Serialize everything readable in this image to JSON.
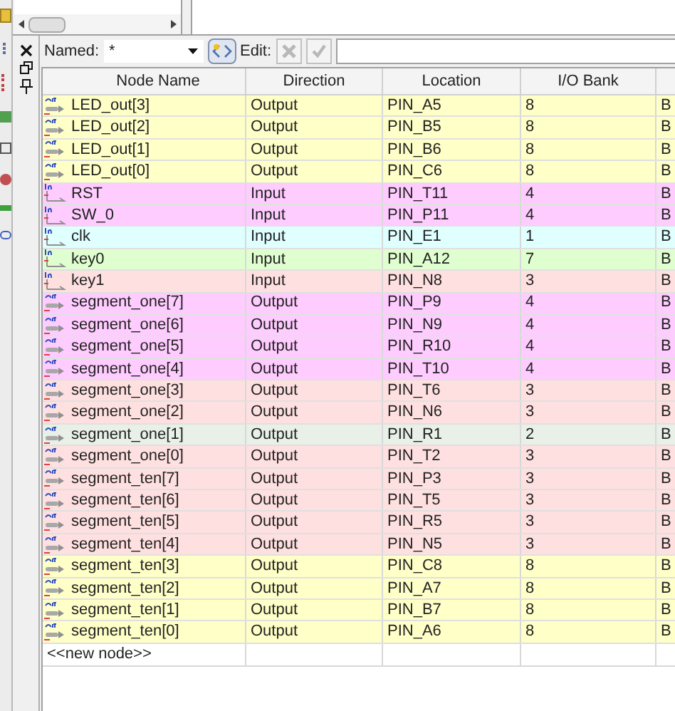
{
  "toolbar": {
    "named_label": "Named:",
    "named_value": "*",
    "edit_label": "Edit:"
  },
  "table": {
    "columns": [
      "Node Name",
      "Direction",
      "Location",
      "I/O Bank"
    ],
    "rows": [
      {
        "kind": "out",
        "name": "LED_out[3]",
        "direction": "Output",
        "location": "PIN_A5",
        "bank": "8",
        "column_5": "B",
        "color": "#ffffc8"
      },
      {
        "kind": "out",
        "name": "LED_out[2]",
        "direction": "Output",
        "location": "PIN_B5",
        "bank": "8",
        "column_5": "B",
        "color": "#ffffc8"
      },
      {
        "kind": "out",
        "name": "LED_out[1]",
        "direction": "Output",
        "location": "PIN_B6",
        "bank": "8",
        "column_5": "B",
        "color": "#ffffc8"
      },
      {
        "kind": "out",
        "name": "LED_out[0]",
        "direction": "Output",
        "location": "PIN_C6",
        "bank": "8",
        "column_5": "B",
        "color": "#ffffc8"
      },
      {
        "kind": "in",
        "name": "RST",
        "direction": "Input",
        "location": "PIN_T11",
        "bank": "4",
        "column_5": "B",
        "color": "#ffccff"
      },
      {
        "kind": "in",
        "name": "SW_0",
        "direction": "Input",
        "location": "PIN_P11",
        "bank": "4",
        "column_5": "B",
        "color": "#ffccff"
      },
      {
        "kind": "in",
        "name": "clk",
        "direction": "Input",
        "location": "PIN_E1",
        "bank": "1",
        "column_5": "B",
        "color": "#e0ffff"
      },
      {
        "kind": "in",
        "name": "key0",
        "direction": "Input",
        "location": "PIN_A12",
        "bank": "7",
        "column_5": "B",
        "color": "#e0ffd0"
      },
      {
        "kind": "in",
        "name": "key1",
        "direction": "Input",
        "location": "PIN_N8",
        "bank": "3",
        "column_5": "B",
        "color": "#ffe0e0"
      },
      {
        "kind": "out",
        "name": "segment_one[7]",
        "direction": "Output",
        "location": "PIN_P9",
        "bank": "4",
        "column_5": "B",
        "color": "#ffccff"
      },
      {
        "kind": "out",
        "name": "segment_one[6]",
        "direction": "Output",
        "location": "PIN_N9",
        "bank": "4",
        "column_5": "B",
        "color": "#ffccff"
      },
      {
        "kind": "out",
        "name": "segment_one[5]",
        "direction": "Output",
        "location": "PIN_R10",
        "bank": "4",
        "column_5": "B",
        "color": "#ffccff"
      },
      {
        "kind": "out",
        "name": "segment_one[4]",
        "direction": "Output",
        "location": "PIN_T10",
        "bank": "4",
        "column_5": "B",
        "color": "#ffccff"
      },
      {
        "kind": "out",
        "name": "segment_one[3]",
        "direction": "Output",
        "location": "PIN_T6",
        "bank": "3",
        "column_5": "B",
        "color": "#ffe0e0"
      },
      {
        "kind": "out",
        "name": "segment_one[2]",
        "direction": "Output",
        "location": "PIN_N6",
        "bank": "3",
        "column_5": "B",
        "color": "#ffe0e0"
      },
      {
        "kind": "out",
        "name": "segment_one[1]",
        "direction": "Output",
        "location": "PIN_R1",
        "bank": "2",
        "column_5": "B",
        "color": "#e8f0e8"
      },
      {
        "kind": "out",
        "name": "segment_one[0]",
        "direction": "Output",
        "location": "PIN_T2",
        "bank": "3",
        "column_5": "B",
        "color": "#ffe0e0"
      },
      {
        "kind": "out",
        "name": "segment_ten[7]",
        "direction": "Output",
        "location": "PIN_P3",
        "bank": "3",
        "column_5": "B",
        "color": "#ffe0e0"
      },
      {
        "kind": "out",
        "name": "segment_ten[6]",
        "direction": "Output",
        "location": "PIN_T5",
        "bank": "3",
        "column_5": "B",
        "color": "#ffe0e0"
      },
      {
        "kind": "out",
        "name": "segment_ten[5]",
        "direction": "Output",
        "location": "PIN_R5",
        "bank": "3",
        "column_5": "B",
        "color": "#ffe0e0"
      },
      {
        "kind": "out",
        "name": "segment_ten[4]",
        "direction": "Output",
        "location": "PIN_N5",
        "bank": "3",
        "column_5": "B",
        "color": "#ffe0e0"
      },
      {
        "kind": "out",
        "name": "segment_ten[3]",
        "direction": "Output",
        "location": "PIN_C8",
        "bank": "8",
        "column_5": "B",
        "color": "#ffffc8"
      },
      {
        "kind": "out",
        "name": "segment_ten[2]",
        "direction": "Output",
        "location": "PIN_A7",
        "bank": "8",
        "column_5": "B",
        "color": "#ffffc8"
      },
      {
        "kind": "out",
        "name": "segment_ten[1]",
        "direction": "Output",
        "location": "PIN_B7",
        "bank": "8",
        "column_5": "B",
        "color": "#ffffc8"
      },
      {
        "kind": "out",
        "name": "segment_ten[0]",
        "direction": "Output",
        "location": "PIN_A6",
        "bank": "8",
        "column_5": "B",
        "color": "#ffffc8"
      }
    ],
    "new_row": "<<new node>>"
  }
}
